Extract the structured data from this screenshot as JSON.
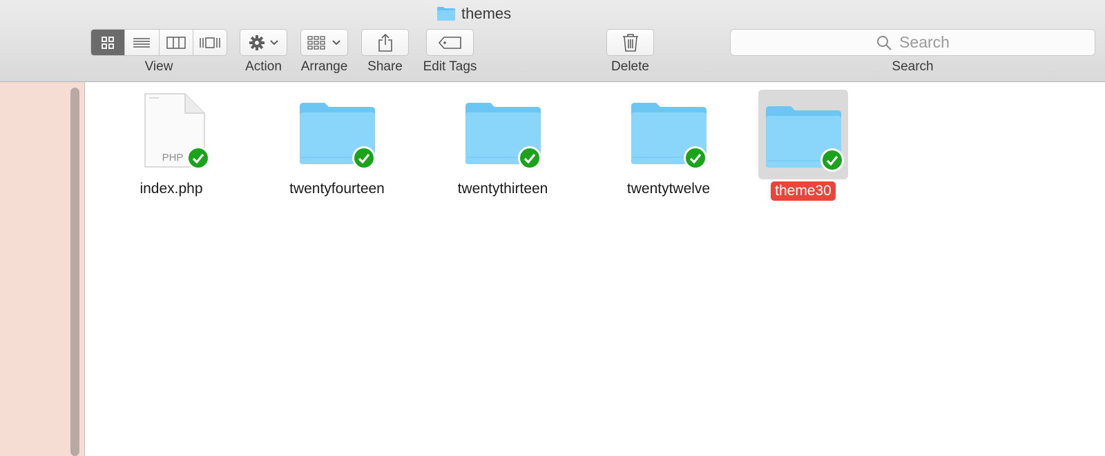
{
  "window": {
    "title": "themes"
  },
  "toolbar": {
    "view_label": "View",
    "action_label": "Action",
    "arrange_label": "Arrange",
    "share_label": "Share",
    "edit_tags_label": "Edit Tags",
    "delete_label": "Delete",
    "search_label": "Search",
    "search_placeholder": "Search",
    "view_modes": [
      "icons",
      "list",
      "columns",
      "cover-flow"
    ],
    "active_view": "icons"
  },
  "items": [
    {
      "name": "index.php",
      "type": "php-file",
      "file_badge": "PHP",
      "synced": true
    },
    {
      "name": "twentyfourteen",
      "type": "folder",
      "synced": true
    },
    {
      "name": "twentythirteen",
      "type": "folder",
      "synced": true
    },
    {
      "name": "twentytwelve",
      "type": "folder",
      "synced": true
    },
    {
      "name": "theme30",
      "type": "folder",
      "synced": true,
      "selected": true,
      "tag_color": "#e8463b"
    }
  ],
  "colors": {
    "folder": "#7fd0f7",
    "check": "#1ba31b",
    "sidebar": "#f5ddd4",
    "selection_tag": "#e8463b"
  }
}
